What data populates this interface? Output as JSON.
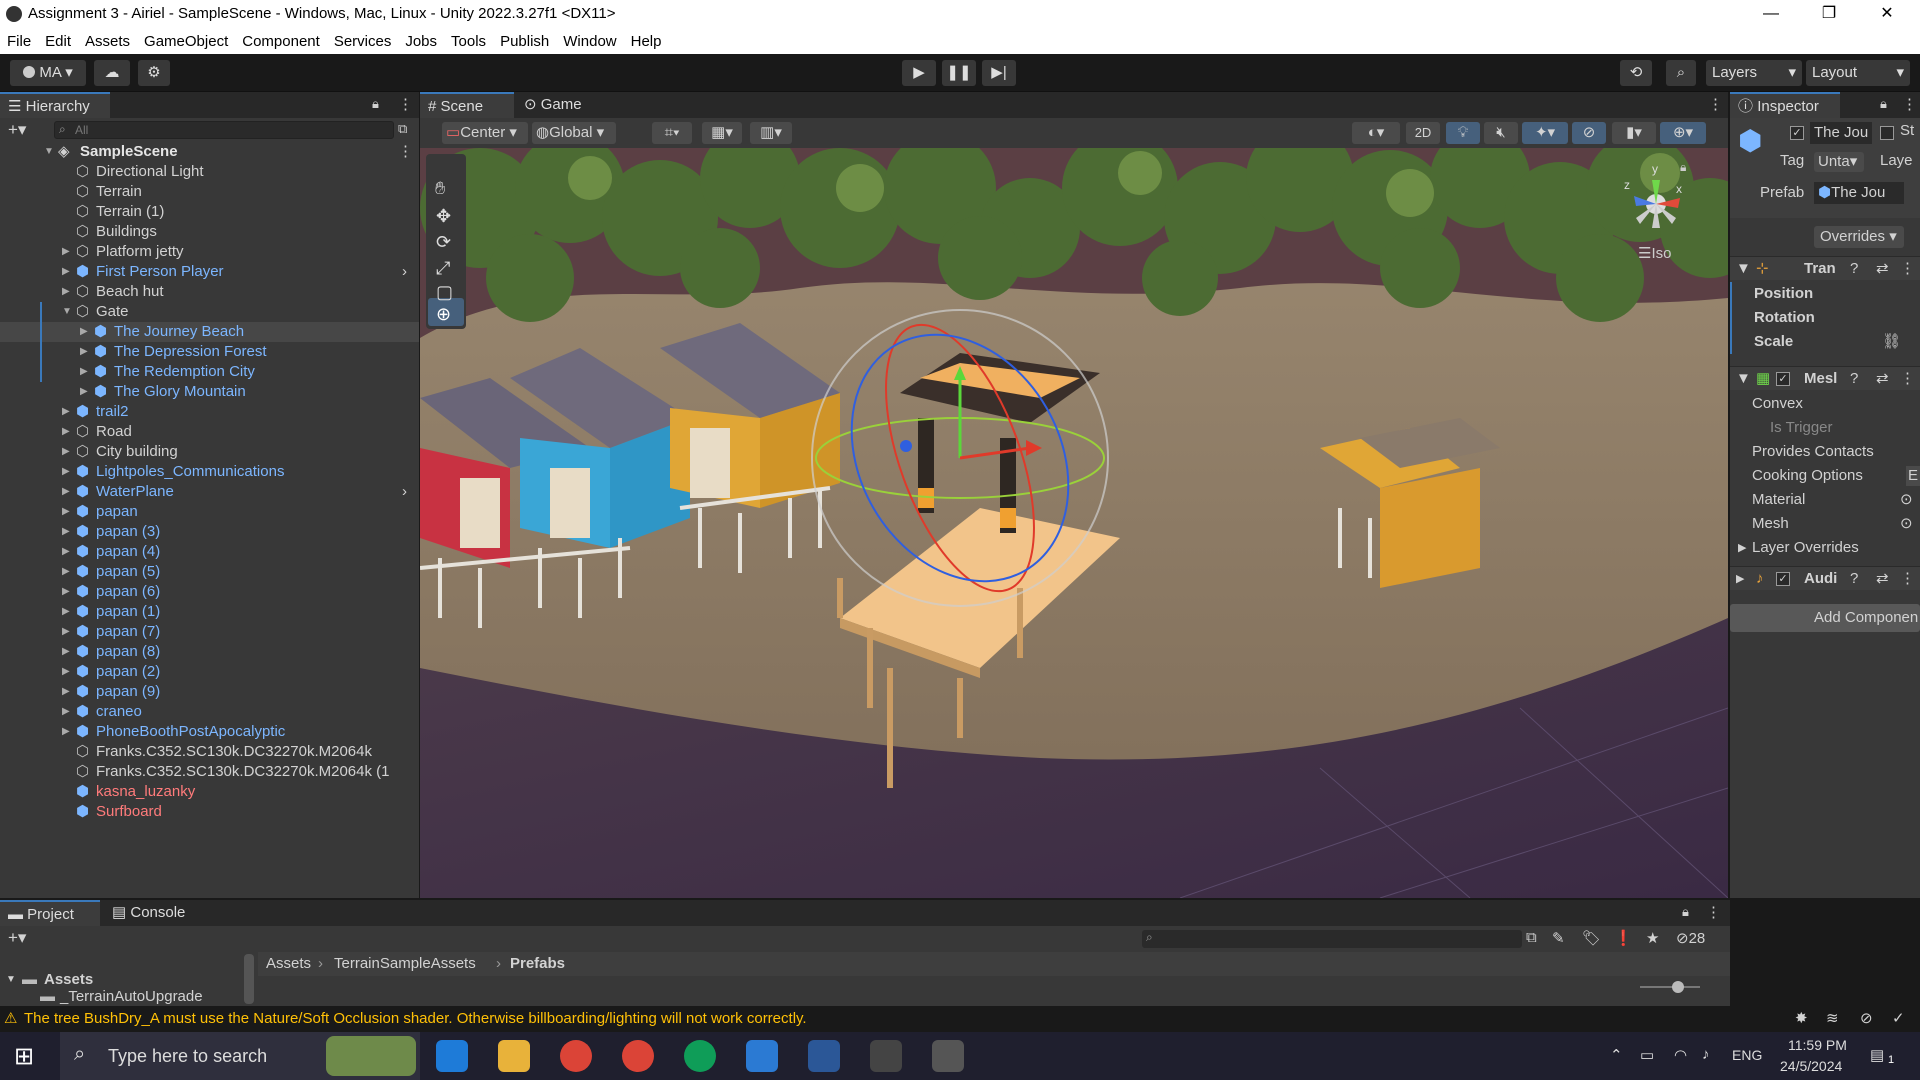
{
  "window": {
    "title": "Assignment 3 - Airiel - SampleScene - Windows, Mac, Linux - Unity 2022.3.27f1 <DX11>",
    "minimize": "—",
    "restore": "❐",
    "close": "✕"
  },
  "menu": [
    "File",
    "Edit",
    "Assets",
    "GameObject",
    "Component",
    "Services",
    "Jobs",
    "Tools",
    "Publish",
    "Window",
    "Help"
  ],
  "toolbar": {
    "account": "MA",
    "layers": "Layers",
    "layout": "Layout"
  },
  "hierarchy": {
    "tab": "Hierarchy",
    "search_placeholder": "All",
    "scene": "SampleScene",
    "items": [
      {
        "label": "Directional Light",
        "color": "white"
      },
      {
        "label": "Terrain",
        "color": "white"
      },
      {
        "label": "Terrain (1)",
        "color": "white"
      },
      {
        "label": "Buildings",
        "color": "white"
      },
      {
        "label": "Platform jetty",
        "color": "white"
      },
      {
        "label": "First Person Player",
        "color": "blue"
      },
      {
        "label": "Beach hut",
        "color": "white"
      },
      {
        "label": "Gate",
        "color": "white"
      },
      {
        "label": "The Journey Beach",
        "color": "blue"
      },
      {
        "label": "The Depression Forest",
        "color": "blue"
      },
      {
        "label": "The Redemption City",
        "color": "blue"
      },
      {
        "label": "The Glory Mountain",
        "color": "blue"
      },
      {
        "label": "trail2",
        "color": "blue"
      },
      {
        "label": "Road",
        "color": "white"
      },
      {
        "label": "City building",
        "color": "white"
      },
      {
        "label": "Lightpoles_Communications",
        "color": "blue"
      },
      {
        "label": "WaterPlane",
        "color": "blue"
      },
      {
        "label": "papan",
        "color": "blue"
      },
      {
        "label": "papan (3)",
        "color": "blue"
      },
      {
        "label": "papan (4)",
        "color": "blue"
      },
      {
        "label": "papan (5)",
        "color": "blue"
      },
      {
        "label": "papan (6)",
        "color": "blue"
      },
      {
        "label": "papan (1)",
        "color": "blue"
      },
      {
        "label": "papan (7)",
        "color": "blue"
      },
      {
        "label": "papan (8)",
        "color": "blue"
      },
      {
        "label": "papan (2)",
        "color": "blue"
      },
      {
        "label": "papan (9)",
        "color": "blue"
      },
      {
        "label": "craneo",
        "color": "blue"
      },
      {
        "label": "PhoneBoothPostApocalyptic",
        "color": "blue"
      },
      {
        "label": "Franks.C352.SC130k.DC32270k.M2064k",
        "color": "white"
      },
      {
        "label": "Franks.C352.SC130k.DC32270k.M2064k (1",
        "color": "white"
      },
      {
        "label": "kasna_luzanky",
        "color": "red"
      },
      {
        "label": "Surfboard",
        "color": "red"
      }
    ]
  },
  "scene": {
    "tab_scene": "Scene",
    "tab_game": "Game",
    "pivot": "Center",
    "space": "Global",
    "mode_2d": "2D",
    "iso": "Iso",
    "axis_y": "y",
    "axis_x": "x",
    "axis_z": "z"
  },
  "inspector": {
    "tab": "Inspector",
    "object_name": "The Jou",
    "static": "St",
    "tag_label": "Tag",
    "tag_value": "Unta",
    "layer_label": "Laye",
    "prefab_label": "Prefab",
    "prefab_value": "The Jou",
    "overrides": "Overrides",
    "transform": "Tran",
    "position": "Position",
    "rotation": "Rotation",
    "scale": "Scale",
    "mesh_collider": "Mesl",
    "convex": "Convex",
    "is_trigger": "Is Trigger",
    "provides_contacts": "Provides Contacts",
    "cooking_options": "Cooking Options",
    "cooking_value": "E",
    "material": "Material",
    "mesh": "Mesh",
    "layer_overrides": "Layer Overrides",
    "audio": "Audi",
    "add_component": "Add Componen"
  },
  "project": {
    "tab_project": "Project",
    "tab_console": "Console",
    "breadcrumb": [
      "Assets",
      "TerrainSampleAssets",
      "Prefabs"
    ],
    "tree_root": "Assets",
    "tree_child": "_TerrainAutoUpgrade",
    "hidden_count": "28"
  },
  "status": {
    "warning": "The tree BushDry_A must use the Nature/Soft Occlusion shader. Otherwise billboarding/lighting will not work correctly."
  },
  "taskbar": {
    "search_placeholder": "Type here to search",
    "language": "ENG",
    "time": "11:59 PM",
    "date": "24/5/2024",
    "notification_count": "1"
  },
  "colors": {
    "accent_blue": "#3a79bb",
    "prefab_blue": "#7cb6ff",
    "missing_red": "#ff7b7b",
    "warning_yellow": "#ffc107"
  }
}
